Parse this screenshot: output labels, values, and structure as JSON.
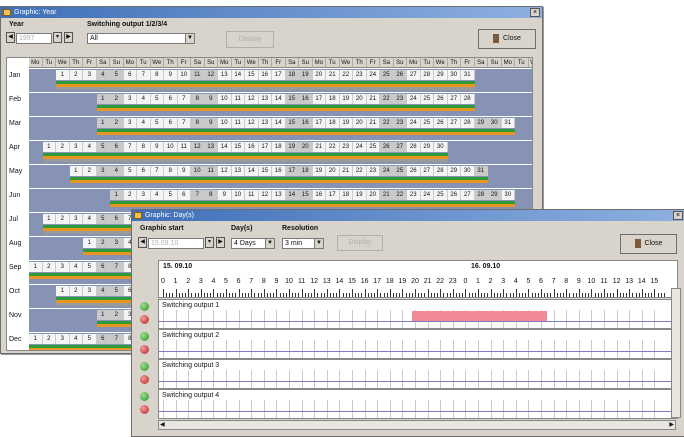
{
  "year_window": {
    "title": "Graphic: Year",
    "year_label": "Year",
    "year_value": "1997",
    "switch_label": "Switching output 1/2/3/4",
    "switch_value": "All",
    "display_label": "Display",
    "close_label": "Close",
    "weekday_headers": [
      "Mo",
      "Tu",
      "We",
      "Th",
      "Fr",
      "Sa",
      "Su",
      "Mo",
      "Tu",
      "We",
      "Th",
      "Fr",
      "Sa",
      "Su",
      "Mo",
      "Tu",
      "We",
      "Th",
      "Fr",
      "Sa",
      "Su",
      "Mo",
      "Tu",
      "We",
      "Th",
      "Fr",
      "Sa",
      "Su",
      "Mo",
      "Tu",
      "We",
      "Th",
      "Fr",
      "Sa",
      "Su",
      "Mo",
      "Tu",
      "We"
    ],
    "months": [
      {
        "name": "Jan",
        "start": 2,
        "days": 31
      },
      {
        "name": "Feb",
        "start": 5,
        "days": 28
      },
      {
        "name": "Mar",
        "start": 5,
        "days": 31
      },
      {
        "name": "Apr",
        "start": 1,
        "days": 30
      },
      {
        "name": "May",
        "start": 3,
        "days": 31
      },
      {
        "name": "Jun",
        "start": 6,
        "days": 30
      },
      {
        "name": "Jul",
        "start": 1,
        "days": 31
      },
      {
        "name": "Aug",
        "start": 4,
        "days": 31
      },
      {
        "name": "Sep",
        "start": 0,
        "days": 30
      },
      {
        "name": "Oct",
        "start": 2,
        "days": 31
      },
      {
        "name": "Nov",
        "start": 5,
        "days": 30
      },
      {
        "name": "Dec",
        "start": 0,
        "days": 31
      }
    ],
    "colors": {
      "bar_green": "#2e9a3a",
      "bar_orange": "#e6951f",
      "bar_gray": "#9a9a9a",
      "row_bg": "#8793b4"
    }
  },
  "day_window": {
    "title": "Graphic: Day(s)",
    "start_label": "Graphic start",
    "start_value": "15.09.10",
    "days_label": "Day(s)",
    "days_value": "4 Days",
    "resolution_label": "Resolution",
    "resolution_value": "3 min",
    "display_label": "Display",
    "close_label": "Close",
    "date1": "15. 09.10",
    "date2": "16. 09.10",
    "hours": [
      "0",
      "1",
      "2",
      "3",
      "4",
      "5",
      "6",
      "7",
      "8",
      "9",
      "10",
      "11",
      "12",
      "13",
      "14",
      "15",
      "16",
      "17",
      "18",
      "19",
      "20",
      "21",
      "22",
      "23",
      "0",
      "1",
      "2",
      "3",
      "4",
      "5",
      "6",
      "7",
      "8",
      "9",
      "10",
      "11",
      "12",
      "13",
      "14",
      "15"
    ],
    "tracks": [
      {
        "name": "Switching output 1",
        "on_start_hour": 19.8,
        "on_end_hour": 30.5
      },
      {
        "name": "Switching output 2"
      },
      {
        "name": "Switching output 3"
      },
      {
        "name": "Switching output 4"
      }
    ],
    "colors": {
      "on_bar": "#f08a96"
    }
  }
}
